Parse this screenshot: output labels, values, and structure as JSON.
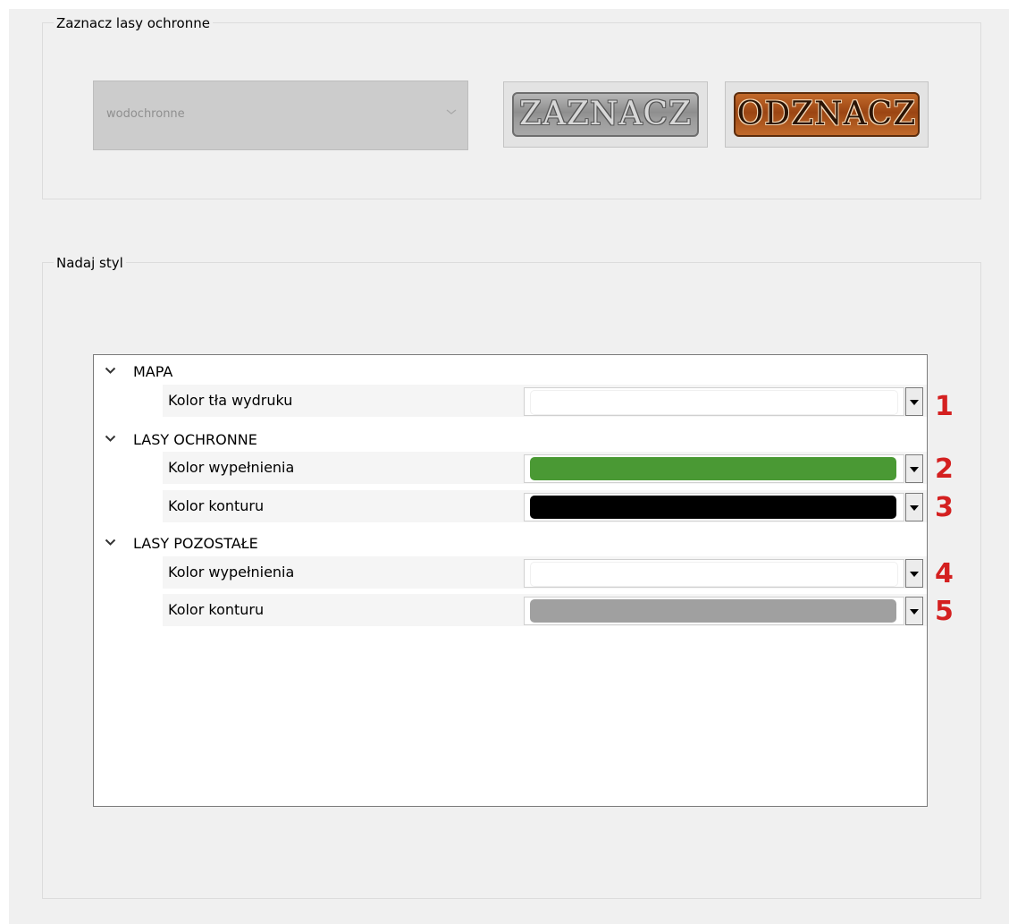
{
  "mark_group": {
    "title": "Zaznacz lasy ochronne",
    "combo": {
      "value": "wodochronne"
    },
    "mark_button": {
      "label": "ZAZNACZ"
    },
    "unmark_button": {
      "label": "ODZNACZ"
    }
  },
  "style_group": {
    "title": "Nadaj styl",
    "categories": [
      {
        "label": "MAPA",
        "properties": [
          {
            "label": "Kolor tła wydruku",
            "color": "#ffffff",
            "marker": "1"
          }
        ]
      },
      {
        "label": "LASY OCHRONNE",
        "properties": [
          {
            "label": "Kolor wypełnienia",
            "color": "#4a9934",
            "marker": "2"
          },
          {
            "label": "Kolor konturu",
            "color": "#000000",
            "marker": "3"
          }
        ]
      },
      {
        "label": "LASY POZOSTAŁE",
        "properties": [
          {
            "label": "Kolor wypełnienia",
            "color": "#ffffff",
            "marker": "4"
          },
          {
            "label": "Kolor konturu",
            "color": "#a0a0a0",
            "marker": "5"
          }
        ]
      }
    ]
  },
  "icons": {
    "expand": "chevron-down-icon",
    "dropdown": "triangle-down-icon"
  }
}
